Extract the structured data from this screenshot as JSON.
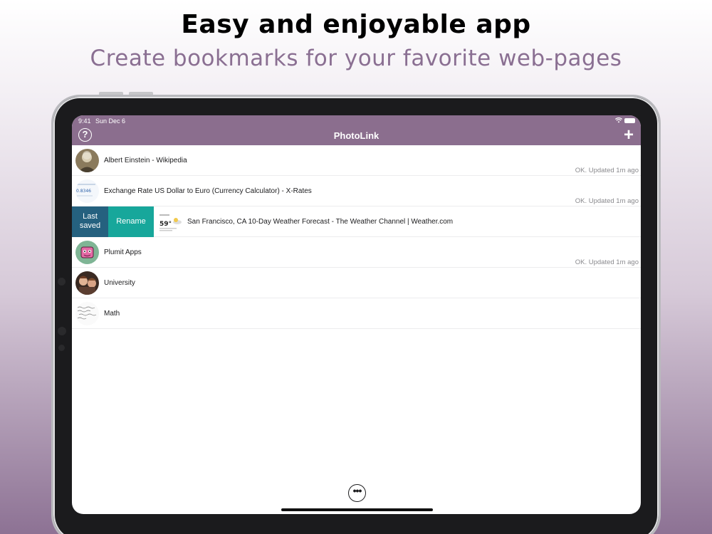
{
  "promo": {
    "headline": "Easy and enjoyable app",
    "subhead": "Create bookmarks for your favorite web-pages"
  },
  "statusbar": {
    "time": "9:41",
    "date": "Sun Dec 6"
  },
  "navbar": {
    "title": "PhotoLink",
    "help_glyph": "?",
    "add_glyph": "+"
  },
  "rows": [
    {
      "name": "Albert Einstein - Wikipedia",
      "status": "OK. Updated 1m ago",
      "thumb": "portrait-photo"
    },
    {
      "name": "Exchange Rate US Dollar to Euro (Currency Calculator) - X-Rates",
      "status": "OK. Updated 1m ago",
      "thumb": "currency-page"
    },
    {
      "name": "San Francisco, CA 10-Day Weather Forecast - The Weather Channel | Weather.com",
      "status": "",
      "thumb": "weather-page",
      "temp": "59°"
    },
    {
      "name": "Plumit Apps",
      "status": "OK. Updated 1m ago",
      "thumb": "pink-creature"
    },
    {
      "name": "University",
      "status": "",
      "thumb": "people-photo"
    },
    {
      "name": "Math",
      "status": "",
      "thumb": "handwriting-page"
    }
  ],
  "swipe_actions": {
    "last_saved": "Last saved",
    "rename": "Rename"
  },
  "toolbar": {
    "more_glyph": "•••"
  },
  "colors": {
    "accent": "#8b6e8e",
    "last_saved": "#25617f",
    "rename": "#17a79b"
  }
}
